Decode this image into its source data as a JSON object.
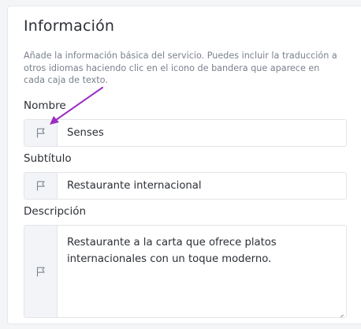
{
  "section": {
    "title": "Información",
    "description": "Añade la información básica del servicio. Puedes incluir la traducción a otros idiomas haciendo clic en el icono de bandera que aparece en cada caja de texto."
  },
  "fields": {
    "nombre": {
      "label": "Nombre",
      "value": "Senses",
      "icon": "flag-icon"
    },
    "subtitulo": {
      "label": "Subtítulo",
      "value": "Restaurante internacional",
      "icon": "flag-icon"
    },
    "descripcion": {
      "label": "Descripción",
      "value": "Restaurante a la carta que ofrece platos internacionales con un toque moderno.",
      "icon": "flag-icon"
    }
  },
  "colors": {
    "annotation_arrow": "#9b2cc4",
    "flag_cell_bg": "#f2f4f7",
    "border": "#e3e5e9"
  }
}
